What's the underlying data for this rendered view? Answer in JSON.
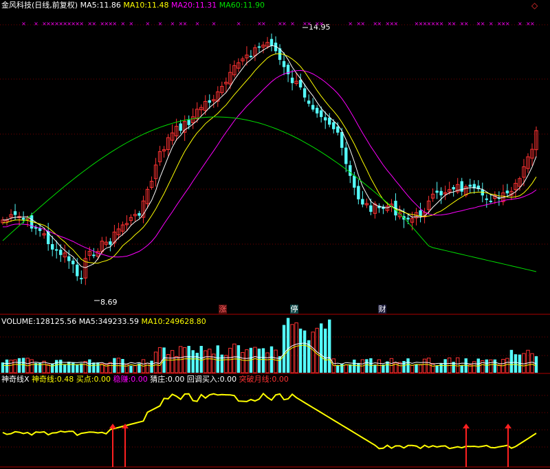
{
  "header": {
    "stock_title": "金风科技(日线,前复权)",
    "ma5_label": "MA5:",
    "ma5_value": "11.86",
    "ma10_label": "MA10:",
    "ma10_value": "11.48",
    "ma20_label": "MA20:",
    "ma20_value": "11.31",
    "ma60_label": "MA60:",
    "ma60_value": "11.90"
  },
  "volume_header": {
    "volume_label": "VOLUME:",
    "volume_value": "128125.56",
    "ma5_label": "MA5:",
    "ma5_value": "349233.59",
    "ma10_label": "MA10:",
    "ma10_value": "249628.80"
  },
  "indicator_header": {
    "name": "神奇线X",
    "line_label": "神奇线:",
    "line_value": "0.48",
    "buy_label": "买点:",
    "buy_value": "0.00",
    "steady_label": "稳赚:",
    "steady_value": "0.00",
    "guess_label": "猜庄:",
    "guess_value": "0.00",
    "pullback_label": "回调买入:",
    "pullback_value": "0.00",
    "breakout_label": "突破月线:",
    "breakout_value": "0.00"
  },
  "annotations": {
    "high_label": "14.95",
    "low_label": "8.69",
    "event_limit_up_short": "涨",
    "event_halt": "停",
    "event_finance": "财"
  },
  "colors": {
    "up": "#ff3232",
    "down": "#54fcfc",
    "ma5": "#ffffff",
    "ma10": "#ffff00",
    "ma20": "#ff00ff",
    "ma60": "#00e000",
    "indicator": "#ffff00",
    "grid": "#7a0000"
  },
  "chart_data": {
    "type": "candlestick",
    "bars": 130,
    "price_high": 14.95,
    "price_low": 8.69,
    "indicator_arrows": 4,
    "window_close_icon": "diamond-icon"
  }
}
